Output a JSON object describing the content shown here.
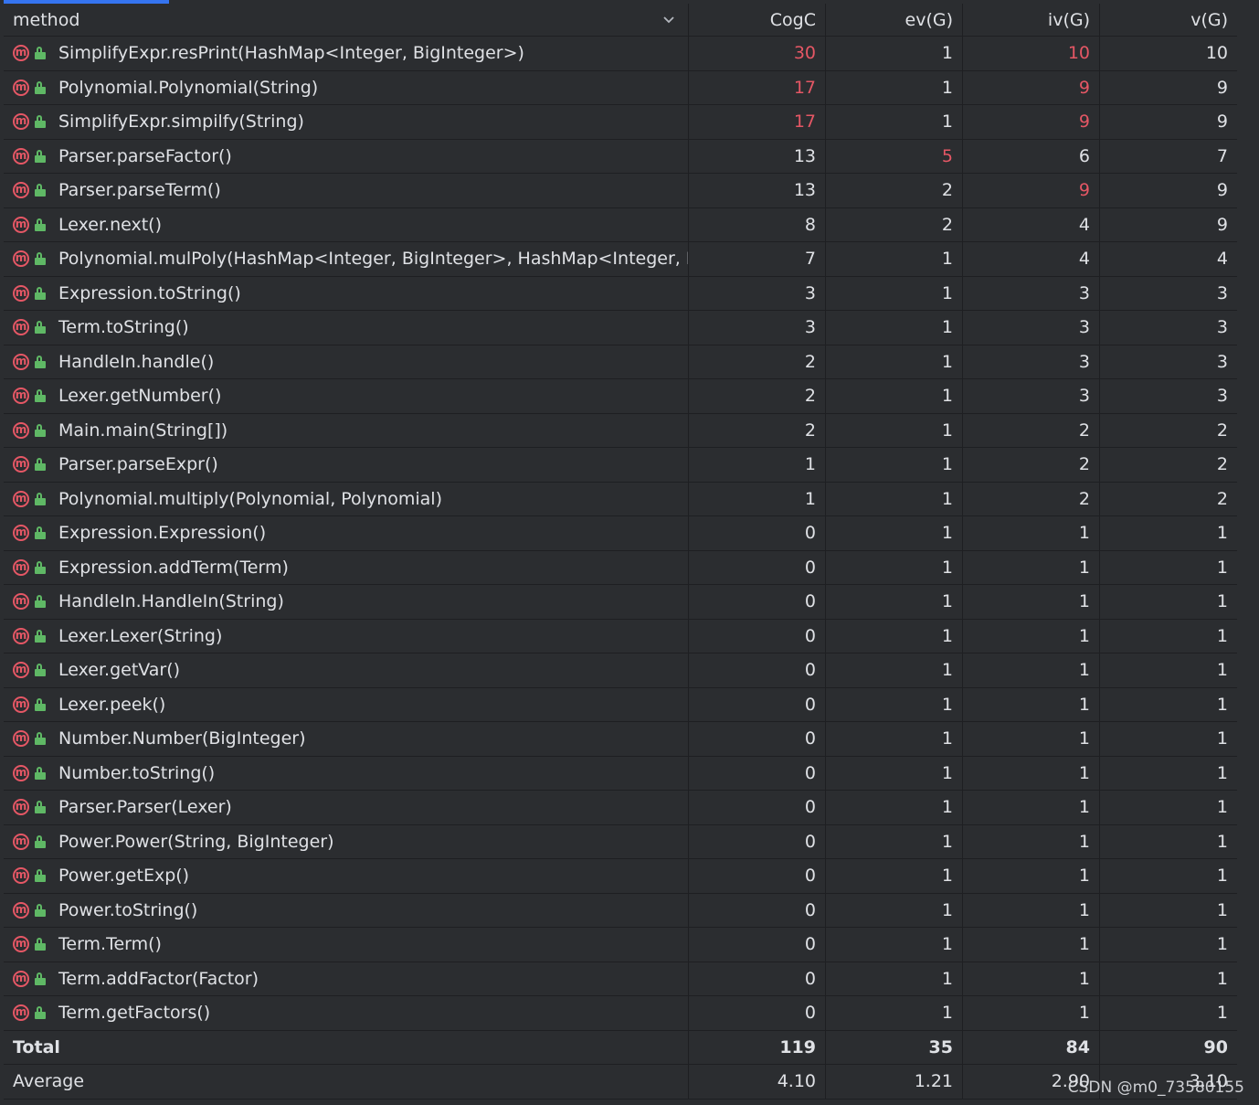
{
  "columns": {
    "method": "method",
    "cogc": "CogC",
    "ev": "ev(G)",
    "iv": "iv(G)",
    "v": "v(G)"
  },
  "rows": [
    {
      "method": "SimplifyExpr.resPrint(HashMap<Integer, BigInteger>)",
      "cogc": "30",
      "ev": "1",
      "iv": "10",
      "v": "10",
      "hot": [
        "cogc",
        "iv"
      ]
    },
    {
      "method": "Polynomial.Polynomial(String)",
      "cogc": "17",
      "ev": "1",
      "iv": "9",
      "v": "9",
      "hot": [
        "cogc",
        "iv"
      ]
    },
    {
      "method": "SimplifyExpr.simpilfy(String)",
      "cogc": "17",
      "ev": "1",
      "iv": "9",
      "v": "9",
      "hot": [
        "cogc",
        "iv"
      ]
    },
    {
      "method": "Parser.parseFactor()",
      "cogc": "13",
      "ev": "5",
      "iv": "6",
      "v": "7",
      "hot": [
        "ev"
      ]
    },
    {
      "method": "Parser.parseTerm()",
      "cogc": "13",
      "ev": "2",
      "iv": "9",
      "v": "9",
      "hot": [
        "iv"
      ]
    },
    {
      "method": "Lexer.next()",
      "cogc": "8",
      "ev": "2",
      "iv": "4",
      "v": "9",
      "hot": []
    },
    {
      "method": "Polynomial.mulPoly(HashMap<Integer, BigInteger>, HashMap<Integer, BigI",
      "cogc": "7",
      "ev": "1",
      "iv": "4",
      "v": "4",
      "hot": []
    },
    {
      "method": "Expression.toString()",
      "cogc": "3",
      "ev": "1",
      "iv": "3",
      "v": "3",
      "hot": []
    },
    {
      "method": "Term.toString()",
      "cogc": "3",
      "ev": "1",
      "iv": "3",
      "v": "3",
      "hot": []
    },
    {
      "method": "HandleIn.handle()",
      "cogc": "2",
      "ev": "1",
      "iv": "3",
      "v": "3",
      "hot": []
    },
    {
      "method": "Lexer.getNumber()",
      "cogc": "2",
      "ev": "1",
      "iv": "3",
      "v": "3",
      "hot": []
    },
    {
      "method": "Main.main(String[])",
      "cogc": "2",
      "ev": "1",
      "iv": "2",
      "v": "2",
      "hot": []
    },
    {
      "method": "Parser.parseExpr()",
      "cogc": "1",
      "ev": "1",
      "iv": "2",
      "v": "2",
      "hot": []
    },
    {
      "method": "Polynomial.multiply(Polynomial, Polynomial)",
      "cogc": "1",
      "ev": "1",
      "iv": "2",
      "v": "2",
      "hot": []
    },
    {
      "method": "Expression.Expression()",
      "cogc": "0",
      "ev": "1",
      "iv": "1",
      "v": "1",
      "hot": []
    },
    {
      "method": "Expression.addTerm(Term)",
      "cogc": "0",
      "ev": "1",
      "iv": "1",
      "v": "1",
      "hot": []
    },
    {
      "method": "HandleIn.HandleIn(String)",
      "cogc": "0",
      "ev": "1",
      "iv": "1",
      "v": "1",
      "hot": []
    },
    {
      "method": "Lexer.Lexer(String)",
      "cogc": "0",
      "ev": "1",
      "iv": "1",
      "v": "1",
      "hot": []
    },
    {
      "method": "Lexer.getVar()",
      "cogc": "0",
      "ev": "1",
      "iv": "1",
      "v": "1",
      "hot": []
    },
    {
      "method": "Lexer.peek()",
      "cogc": "0",
      "ev": "1",
      "iv": "1",
      "v": "1",
      "hot": []
    },
    {
      "method": "Number.Number(BigInteger)",
      "cogc": "0",
      "ev": "1",
      "iv": "1",
      "v": "1",
      "hot": []
    },
    {
      "method": "Number.toString()",
      "cogc": "0",
      "ev": "1",
      "iv": "1",
      "v": "1",
      "hot": []
    },
    {
      "method": "Parser.Parser(Lexer)",
      "cogc": "0",
      "ev": "1",
      "iv": "1",
      "v": "1",
      "hot": []
    },
    {
      "method": "Power.Power(String, BigInteger)",
      "cogc": "0",
      "ev": "1",
      "iv": "1",
      "v": "1",
      "hot": []
    },
    {
      "method": "Power.getExp()",
      "cogc": "0",
      "ev": "1",
      "iv": "1",
      "v": "1",
      "hot": []
    },
    {
      "method": "Power.toString()",
      "cogc": "0",
      "ev": "1",
      "iv": "1",
      "v": "1",
      "hot": []
    },
    {
      "method": "Term.Term()",
      "cogc": "0",
      "ev": "1",
      "iv": "1",
      "v": "1",
      "hot": []
    },
    {
      "method": "Term.addFactor(Factor)",
      "cogc": "0",
      "ev": "1",
      "iv": "1",
      "v": "1",
      "hot": []
    },
    {
      "method": "Term.getFactors()",
      "cogc": "0",
      "ev": "1",
      "iv": "1",
      "v": "1",
      "hot": []
    }
  ],
  "total": {
    "label": "Total",
    "cogc": "119",
    "ev": "35",
    "iv": "84",
    "v": "90"
  },
  "average": {
    "label": "Average",
    "cogc": "4.10",
    "ev": "1.21",
    "iv": "2.90",
    "v": "3.10"
  },
  "watermark": "CSDN @m0_73580155",
  "colors": {
    "hot": "#e55765",
    "method_icon": "#e55765",
    "lock_icon": "#5fb865",
    "accent": "#3574f0"
  },
  "icons": {
    "method": "method-m-icon",
    "visibility": "public-lock-icon",
    "sort": "chevron-down-icon"
  }
}
